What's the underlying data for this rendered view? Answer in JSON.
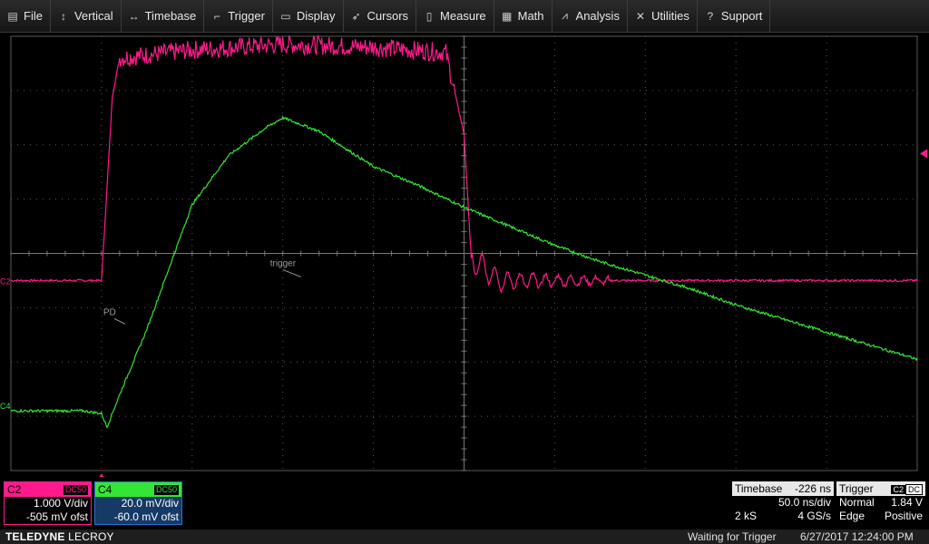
{
  "menu": {
    "items": [
      {
        "id": "file",
        "label": "File",
        "icon": "file-icon",
        "glyph": "▤"
      },
      {
        "id": "vertical",
        "label": "Vertical",
        "icon": "vertical-arrows-icon",
        "glyph": "↕"
      },
      {
        "id": "timebase",
        "label": "Timebase",
        "icon": "horizontal-arrows-icon",
        "glyph": "↔"
      },
      {
        "id": "trigger",
        "label": "Trigger",
        "icon": "trigger-edge-icon",
        "glyph": "⌐"
      },
      {
        "id": "display",
        "label": "Display",
        "icon": "display-icon",
        "glyph": "▭"
      },
      {
        "id": "cursors",
        "label": "Cursors",
        "icon": "cursor-arrow-icon",
        "glyph": "➶"
      },
      {
        "id": "measure",
        "label": "Measure",
        "icon": "measure-icon",
        "glyph": "▯"
      },
      {
        "id": "math",
        "label": "Math",
        "icon": "calculator-icon",
        "glyph": "▦"
      },
      {
        "id": "analysis",
        "label": "Analysis",
        "icon": "analysis-chart-icon",
        "glyph": "⩘"
      },
      {
        "id": "utilities",
        "label": "Utilities",
        "icon": "wrench-icon",
        "glyph": "✕"
      },
      {
        "id": "support",
        "label": "Support",
        "icon": "help-icon",
        "glyph": "?"
      }
    ]
  },
  "colors": {
    "c2": "#ff1a8c",
    "c4": "#33e633",
    "c4_box_border": "#2f6fc8",
    "c4_box_bg": "#153a66",
    "grid": "#5a5a5a"
  },
  "markers": {
    "c2_label": "C2",
    "c4_label": "C4",
    "trigger_label": "trigger",
    "pd_label": "PD"
  },
  "channels": {
    "c2": {
      "name": "C2",
      "coupling": "DC50",
      "vdiv": "1.000 V/div",
      "offset": "-505 mV ofst"
    },
    "c4": {
      "name": "C4",
      "coupling": "DC50",
      "vdiv": "20.0 mV/div",
      "offset": "-60.0 mV ofst"
    }
  },
  "timebase": {
    "title": "Timebase",
    "delay": "-226 ns",
    "per_div": "50.0 ns/div",
    "samples": "2 kS",
    "rate": "4 GS/s"
  },
  "trigger": {
    "title": "Trigger",
    "source": "C2",
    "coupling": "DC",
    "mode": "Normal",
    "level": "1.84 V",
    "type": "Edge",
    "slope": "Positive"
  },
  "status": {
    "brand_bold": "TELEDYNE",
    "brand_light": "LECROY",
    "message": "Waiting for Trigger",
    "datetime": "6/27/2017 12:24:00 PM"
  },
  "chart_data": {
    "type": "line",
    "grid": {
      "x_divisions": 10,
      "y_divisions": 8
    },
    "x_unit": "ns",
    "time_per_div": 50,
    "series": [
      {
        "name": "C2",
        "x": [
          0,
          10,
          20,
          40,
          50,
          56,
          60,
          100,
          150,
          200,
          240,
          250,
          254,
          270,
          300,
          350,
          400,
          450,
          500
        ],
        "y": [
          -0.5,
          -0.5,
          -0.5,
          -0.5,
          -0.5,
          2.9,
          3.6,
          3.75,
          3.85,
          3.8,
          3.7,
          2.2,
          -0.1,
          -0.5,
          -0.5,
          -0.5,
          -0.5,
          -0.5,
          -0.5
        ]
      },
      {
        "name": "C4",
        "x": [
          0,
          40,
          50,
          53,
          60,
          75,
          100,
          120,
          140,
          150,
          170,
          200,
          225,
          250,
          275,
          300,
          325,
          350,
          375,
          400,
          425,
          450,
          475,
          500
        ],
        "y": [
          -2.9,
          -2.9,
          -2.95,
          -3.2,
          -2.6,
          -1.4,
          0.9,
          1.8,
          2.3,
          2.5,
          2.25,
          1.6,
          1.25,
          0.85,
          0.5,
          0.15,
          -0.15,
          -0.4,
          -0.65,
          -0.95,
          -1.2,
          -1.45,
          -1.7,
          -1.95
        ]
      }
    ]
  }
}
